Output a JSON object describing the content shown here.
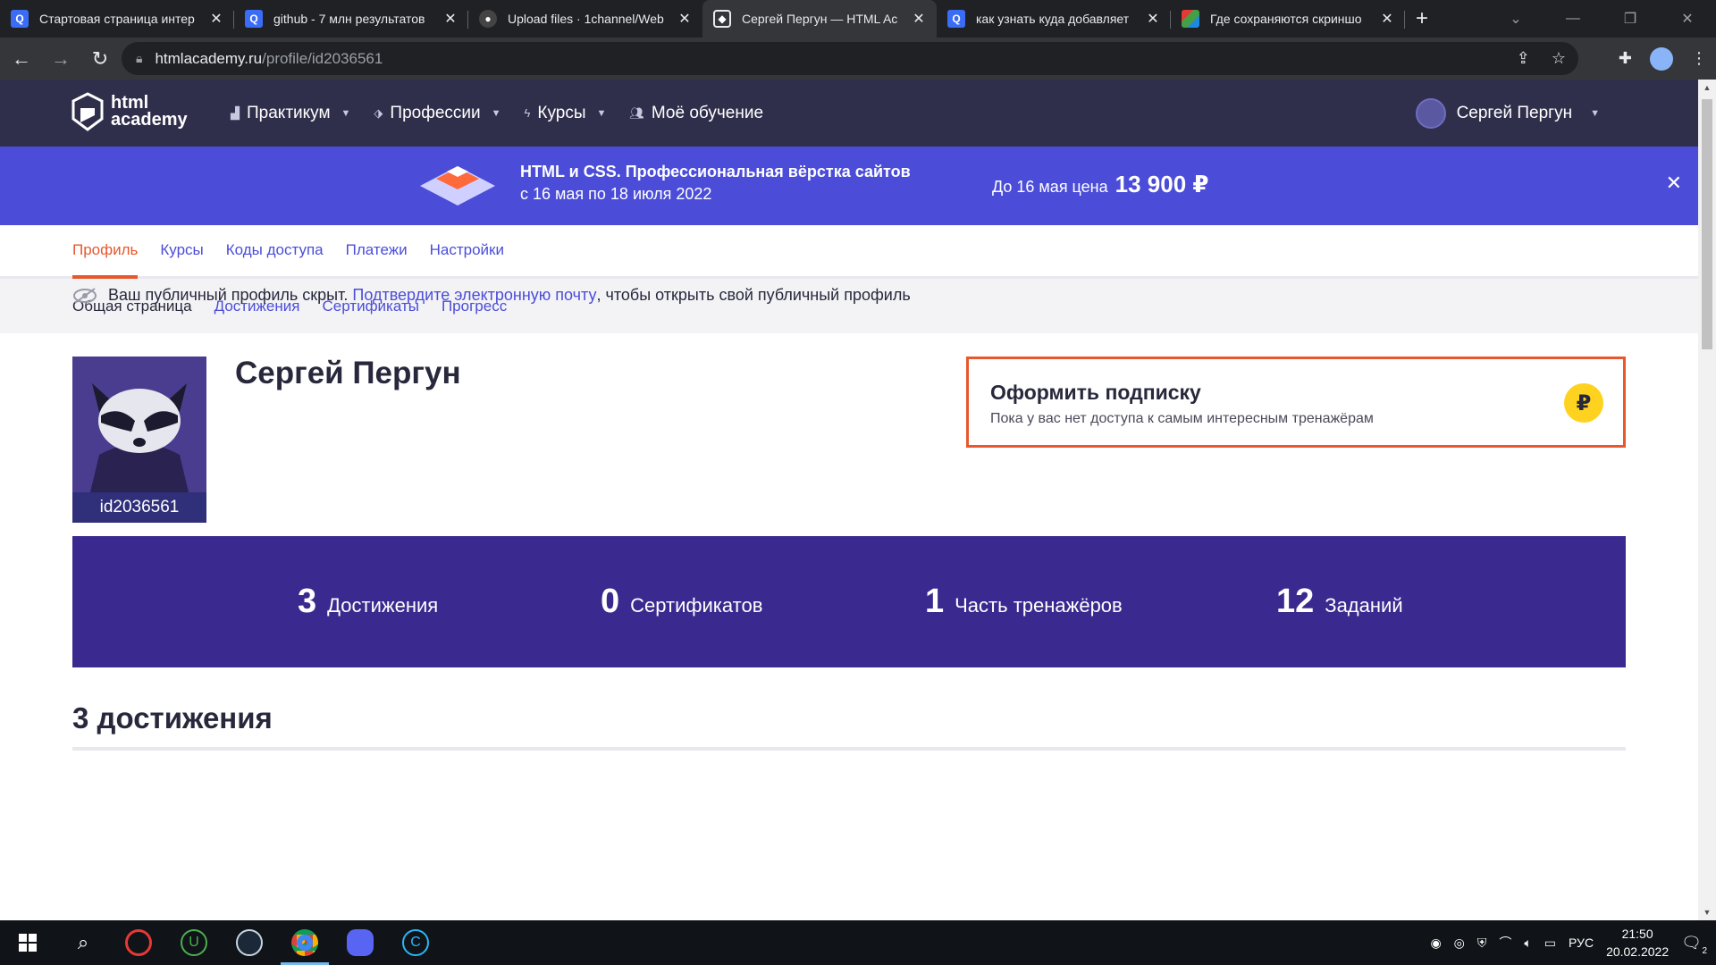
{
  "browser": {
    "tabs": [
      {
        "title": "Стартовая страница интер",
        "favicon": "search-icon",
        "color": "#3b6cf6",
        "active": false
      },
      {
        "title": "github - 7 млн результатов",
        "favicon": "search-icon",
        "color": "#3b6cf6",
        "active": false
      },
      {
        "title": "Upload files · 1channel/Web",
        "favicon": "github-icon",
        "color": "#444",
        "active": false
      },
      {
        "title": "Сергей Пергун — HTML Ac",
        "favicon": "htmlacademy-icon",
        "color": "#35363a",
        "active": true
      },
      {
        "title": "как узнать куда добавляет",
        "favicon": "search-icon",
        "color": "#3b6cf6",
        "active": false
      },
      {
        "title": "Где сохраняются скриншо",
        "favicon": "site-icon",
        "color": "#2e7d32",
        "active": false
      }
    ],
    "url_host": "htmlacademy.ru",
    "url_path": "/profile/id2036561"
  },
  "site": {
    "logo_line1": "html",
    "logo_line2": "academy",
    "nav": [
      {
        "label": "Практикум",
        "icon": "bar-chart-icon",
        "has_caret": true
      },
      {
        "label": "Профессии",
        "icon": "graduation-cap-icon",
        "has_caret": true
      },
      {
        "label": "Курсы",
        "icon": "lightning-icon",
        "has_caret": true
      },
      {
        "label": "Моё обучение",
        "icon": "people-icon",
        "has_caret": false
      }
    ],
    "user_name": "Сергей Пергун"
  },
  "promo": {
    "title": "HTML и CSS. Профессиональная вёрстка сайтов",
    "dates": "с 16 мая по 18 июля 2022",
    "price_prefix": "До 16 мая цена",
    "price": "13 900 ₽",
    "close": "✕"
  },
  "profile_tabs": [
    {
      "label": "Профиль",
      "active": true
    },
    {
      "label": "Курсы",
      "active": false
    },
    {
      "label": "Коды доступа",
      "active": false
    },
    {
      "label": "Платежи",
      "active": false
    },
    {
      "label": "Настройки",
      "active": false
    }
  ],
  "sub_tabs": [
    {
      "label": "Общая страница",
      "active": true
    },
    {
      "label": "Достижения",
      "active": false
    },
    {
      "label": "Сертификаты",
      "active": false
    },
    {
      "label": "Прогресс",
      "active": false
    }
  ],
  "notice": {
    "before": "Ваш публичный профиль скрыт.",
    "link": "Подтвердите электронную почту",
    "after": ", чтобы открыть свой публичный профиль"
  },
  "profile": {
    "name": "Сергей Пергун",
    "id": "id2036561"
  },
  "subscription": {
    "title": "Оформить подписку",
    "desc": "Пока у вас нет доступа к самым интересным тренажёрам",
    "coin": "₽"
  },
  "stats": [
    {
      "num": "3",
      "label": "Достижения"
    },
    {
      "num": "0",
      "label": "Сертификатов"
    },
    {
      "num": "1",
      "label": "Часть тренажёров"
    },
    {
      "num": "12",
      "label": "Заданий"
    }
  ],
  "achievements_heading": "3 достижения",
  "taskbar": {
    "lang": "РУС",
    "time": "21:50",
    "date": "20.02.2022",
    "notif_count": "2"
  }
}
